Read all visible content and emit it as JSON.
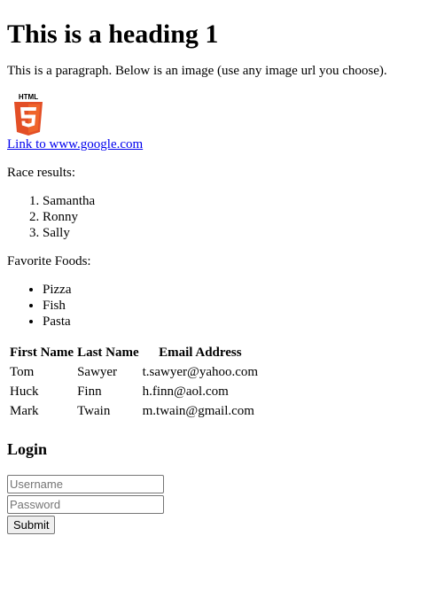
{
  "heading": "This is a heading 1",
  "intro": "This is a paragraph. Below is an image (use any image url you choose).",
  "logo": {
    "icon": "html5-logo-icon",
    "text": "HTML",
    "digit": "5",
    "color": "#e34f26",
    "accent": "#ef652a"
  },
  "link": {
    "text": "Link to www.google.com",
    "href": "http://www.google.com"
  },
  "race": {
    "label": "Race results:",
    "items": [
      "Samantha",
      "Ronny",
      "Sally"
    ]
  },
  "foods": {
    "label": "Favorite Foods:",
    "items": [
      "Pizza",
      "Fish",
      "Pasta"
    ]
  },
  "table": {
    "headers": [
      "First Name",
      "Last Name",
      "Email Address"
    ],
    "rows": [
      [
        "Tom",
        "Sawyer",
        "t.sawyer@yahoo.com"
      ],
      [
        "Huck",
        "Finn",
        "h.finn@aol.com"
      ],
      [
        "Mark",
        "Twain",
        "m.twain@gmail.com"
      ]
    ]
  },
  "login": {
    "title": "Login",
    "username_placeholder": "Username",
    "password_placeholder": "Password",
    "submit_label": "Submit"
  }
}
